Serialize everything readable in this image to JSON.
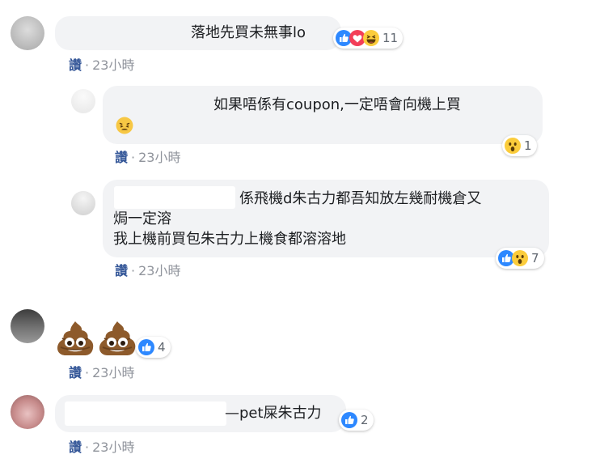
{
  "like_label": "讚",
  "dot": "·",
  "comments": [
    {
      "text": "落地先買未無事lo",
      "time": "23小時",
      "reaction_count": "11",
      "reactions": [
        "like-icon",
        "love-icon",
        "haha-icon"
      ]
    },
    {
      "text_line1": "如果唔係有coupon,一定唔會向機上買",
      "emoji": "tired-face-emoji",
      "time": "23小時",
      "reaction_count": "1",
      "reactions": [
        "wow-icon"
      ]
    },
    {
      "text_line1": "係飛機d朱古力都吾知放左幾耐機倉又",
      "text_line2": "焗一定溶",
      "text_line3": "我上機前買包朱古力上機食都溶溶地",
      "time": "23小時",
      "reaction_count": "7",
      "reactions": [
        "like-icon",
        "wow-icon"
      ]
    },
    {
      "emoji": "pile-of-poo-emoji",
      "time": "23小時",
      "reaction_count": "4",
      "reactions": [
        "like-icon"
      ]
    },
    {
      "text": "—pet屎朱古力",
      "time": "23小時",
      "reaction_count": "2",
      "reactions": [
        "like-icon"
      ]
    }
  ]
}
